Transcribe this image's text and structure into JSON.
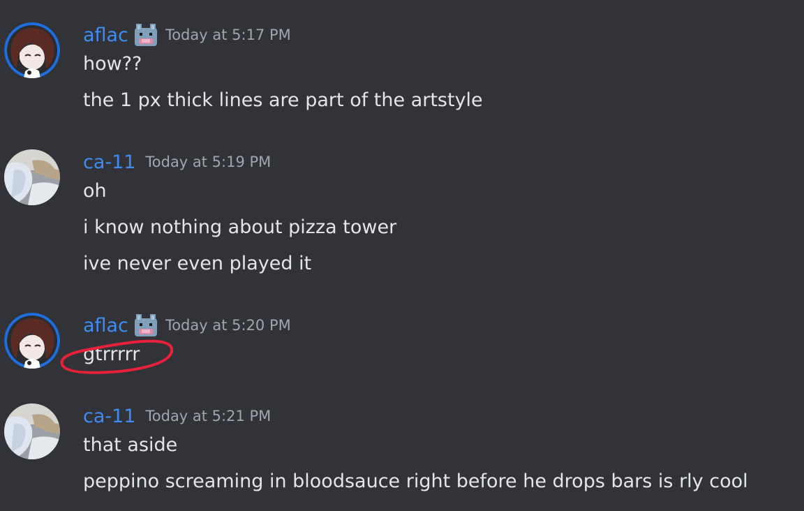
{
  "colors": {
    "background": "#313338",
    "username": "#3f8cf2",
    "timestamp": "#a2a5ad",
    "message_text": "#e3e5e8",
    "annotation_circle": "#e8213a"
  },
  "messages": [
    {
      "author": "aflac",
      "has_badge": true,
      "badge_icon": "pixel-cat-badge-icon",
      "avatar_icon": "anime-girl-avatar-icon",
      "timestamp": "Today at 5:17 PM",
      "lines": [
        "how??",
        "the 1 px thick lines are part of the artstyle"
      ]
    },
    {
      "author": "ca-11",
      "has_badge": false,
      "avatar_icon": "photo-avatar-icon",
      "timestamp": "Today at 5:19 PM",
      "lines": [
        "oh",
        "i know nothing about pizza tower",
        "ive never even played it"
      ]
    },
    {
      "author": "aflac",
      "has_badge": true,
      "badge_icon": "pixel-cat-badge-icon",
      "avatar_icon": "anime-girl-avatar-icon",
      "timestamp": "Today at 5:20 PM",
      "lines": [
        "gtrrrrr"
      ]
    },
    {
      "author": "ca-11",
      "has_badge": false,
      "avatar_icon": "photo-avatar-icon",
      "timestamp": "Today at 5:21 PM",
      "lines": [
        "that aside",
        "peppino screaming in bloodsauce right before he drops bars is rly cool"
      ]
    }
  ]
}
